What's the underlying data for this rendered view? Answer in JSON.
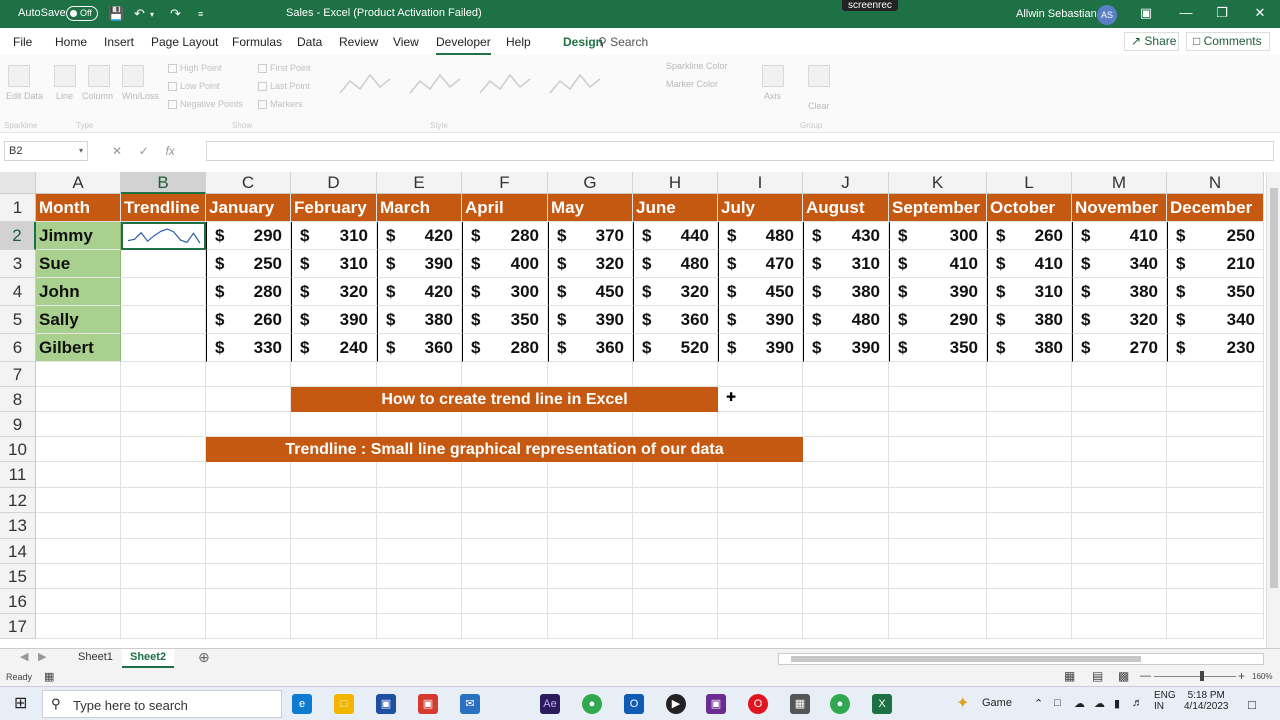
{
  "titlebar": {
    "autosave_label": "AutoSave",
    "toggle_label": "Off",
    "title": "Sales  -  Excel (Product Activation Failed)",
    "screenrec": "screenrec",
    "user": "Allwin Sebastian",
    "avatar": "AS"
  },
  "menu": {
    "items": [
      "File",
      "Home",
      "Insert",
      "Page Layout",
      "Formulas",
      "Data",
      "Review",
      "View",
      "Developer",
      "Help",
      "Design"
    ],
    "search": "Search",
    "share": "Share",
    "comments": "Comments"
  },
  "ribbon": {
    "buttons": [
      "Edit Data",
      "Line",
      "Column",
      "Win/Loss",
      "Axis",
      "Clear"
    ],
    "checks": [
      "High Point",
      "Low Point",
      "Negative Points",
      "First Point",
      "Last Point",
      "Markers"
    ],
    "color": [
      "Sparkline Color",
      "Marker Color"
    ],
    "groups": [
      "Sparkline",
      "Type",
      "Show",
      "Style",
      "Group"
    ]
  },
  "formula": {
    "namebox": "B2",
    "fx": "fx",
    "content": ""
  },
  "columns": [
    "A",
    "B",
    "C",
    "D",
    "E",
    "F",
    "G",
    "H",
    "I",
    "J",
    "K",
    "L",
    "M",
    "N"
  ],
  "rows": [
    "1",
    "2",
    "3",
    "4",
    "5",
    "6",
    "7",
    "8",
    "9",
    "10",
    "11",
    "12",
    "13",
    "14",
    "15",
    "16",
    "17"
  ],
  "table": {
    "headers": [
      "Month",
      "Trendline",
      "January",
      "February",
      "March",
      "April",
      "May",
      "June",
      "July",
      "August",
      "September",
      "October",
      "November",
      "December"
    ],
    "currency": "$",
    "names": [
      "Jimmy",
      "Sue",
      "John",
      "Sally",
      "Gilbert"
    ],
    "values": [
      [
        "290",
        "310",
        "420",
        "280",
        "370",
        "440",
        "480",
        "430",
        "300",
        "260",
        "410",
        "250"
      ],
      [
        "250",
        "310",
        "390",
        "400",
        "320",
        "480",
        "470",
        "310",
        "410",
        "410",
        "340",
        "210"
      ],
      [
        "280",
        "320",
        "420",
        "300",
        "450",
        "320",
        "450",
        "380",
        "390",
        "310",
        "380",
        "350"
      ],
      [
        "260",
        "390",
        "380",
        "350",
        "390",
        "360",
        "390",
        "480",
        "290",
        "380",
        "320",
        "340"
      ],
      [
        "330",
        "240",
        "360",
        "280",
        "360",
        "520",
        "390",
        "390",
        "350",
        "380",
        "270",
        "230"
      ]
    ]
  },
  "banners": {
    "banner1": "How to create trend line in Excel",
    "banner2": "Trendline : Small line graphical representation of our data"
  },
  "sheets": [
    "Sheet1",
    "Sheet2"
  ],
  "status": {
    "ready": "Ready",
    "zoom": "160%"
  },
  "taskbar": {
    "search_placeholder": "Type here to search",
    "game": "Game",
    "lang": "ENG",
    "region": "IN",
    "time": "5:18 PM",
    "date": "4/14/2023"
  },
  "colors": {
    "excel_green": "#1e7145",
    "header_orange": "#c65911",
    "name_green": "#a9d08e"
  }
}
